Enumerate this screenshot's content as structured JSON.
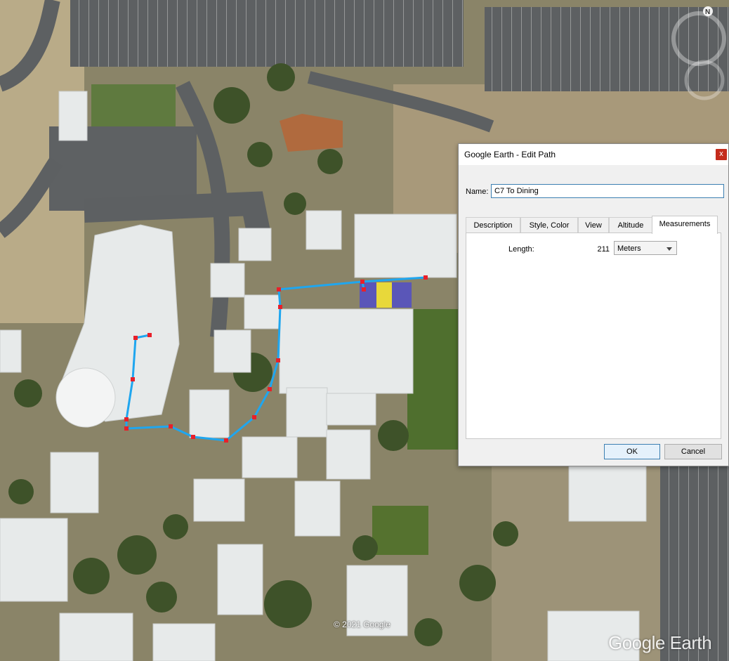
{
  "map": {
    "copyright": "© 2021 Google",
    "brand": "Google Earth",
    "compass_label": "N",
    "path_color": "#1fa6ef",
    "vertex_color": "#e8202a"
  },
  "dialog": {
    "title": "Google Earth - Edit Path",
    "close_glyph": "x",
    "name_label": "Name:",
    "name_value": "C7 To Dining",
    "tabs": [
      {
        "label": "Description"
      },
      {
        "label": "Style, Color"
      },
      {
        "label": "View"
      },
      {
        "label": "Altitude"
      },
      {
        "label": "Measurements"
      }
    ],
    "active_tab": "Measurements",
    "measurements": {
      "length_label": "Length:",
      "length_value": "211",
      "units": "Meters"
    },
    "ok_label": "OK",
    "cancel_label": "Cancel"
  }
}
